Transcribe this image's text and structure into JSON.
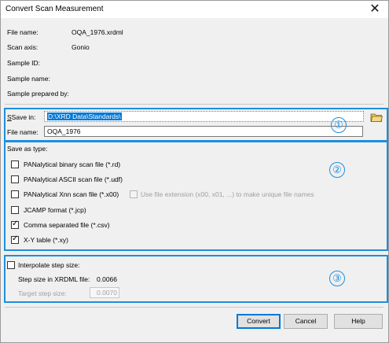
{
  "window": {
    "title": "Convert Scan Measurement",
    "close_symbol": "✕"
  },
  "info": [
    {
      "label": "File name:",
      "value": "OQA_1976.xrdml"
    },
    {
      "label": "Scan axis:",
      "value": "Gonio"
    },
    {
      "label": "Sample ID:",
      "value": ""
    },
    {
      "label": "Sample name:",
      "value": ""
    },
    {
      "label": "Sample prepared by:",
      "value": ""
    }
  ],
  "save": {
    "save_in_label": "Save in:",
    "save_in_value": "D:\\XRD Data\\Standards\\",
    "file_name_label": "File name:",
    "file_name_value": "OQA_1976",
    "marker": "①"
  },
  "save_as": {
    "label": "Save as type:",
    "marker": "②",
    "options": [
      {
        "label": "PANalytical binary scan file (*.rd)",
        "checked": false
      },
      {
        "label": "PANalytical ASCII scan file (*.udf)",
        "checked": false
      },
      {
        "label": "PANalytical Xnn scan file (*.x00)",
        "checked": false
      },
      {
        "label": "JCAMP format (*.jcp)",
        "checked": false
      },
      {
        "label": "Comma separated file (*.csv)",
        "checked": true
      },
      {
        "label": "X-Y table (*.xy)",
        "checked": true
      }
    ],
    "extension_option": {
      "label": "Use file extension (x00, x01, ...) to make unique file names",
      "checked": false,
      "enabled": false
    }
  },
  "step": {
    "marker": "③",
    "interpolate_label": "Interpolate step size:",
    "interpolate_checked": false,
    "step_size_label": "Step size in XRDML file:",
    "step_size_value": "0.0066",
    "target_label": "Target step size:",
    "target_value": "0.0070"
  },
  "buttons": {
    "convert": "Convert",
    "cancel": "Cancel",
    "help": "Help"
  },
  "colors": {
    "accent": "#1e8fdc",
    "selection": "#0078d7"
  }
}
